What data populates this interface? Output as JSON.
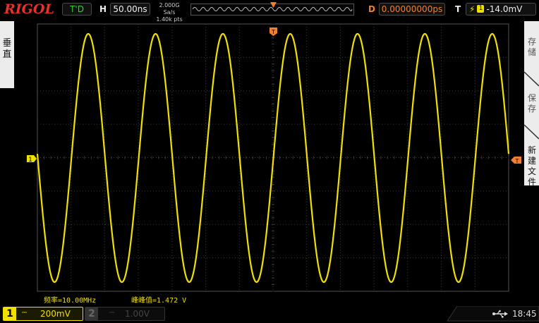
{
  "topbar": {
    "logo": "RIGOL",
    "run_state": "T'D",
    "h_label": "H",
    "timebase": "50.00ns",
    "sample_rate": "2.000G Sa/s",
    "memory_depth": "1.40k pts",
    "d_label": "D",
    "delay": "0.00000000ps",
    "t_label": "T",
    "trigger_source": "1",
    "trigger_level": "-14.0mV"
  },
  "left_tab": {
    "label": "垂直"
  },
  "right_panel": {
    "items": [
      "存储",
      "保存",
      "新建文件"
    ]
  },
  "markers": {
    "channel_marker": "1",
    "trigger_level_marker": "T",
    "trigger_position_marker": "T"
  },
  "measurements": [
    {
      "text": "频率=10.00MHz"
    },
    {
      "text": "峰峰值=1.472 V"
    }
  ],
  "bottombar": {
    "ch1_number": "1",
    "ch1_coupling": "⎓",
    "ch1_scale": "200mV",
    "ch2_number": "2",
    "ch2_coupling": "⎓",
    "ch2_scale": "1.00V",
    "clock": "18:45"
  },
  "colors": {
    "trace": "#f0e000",
    "trigger": "#f08030",
    "grid": "#3c3c3c"
  },
  "chart_data": {
    "type": "line",
    "series": [
      {
        "waveform": "sine",
        "frequency_hz": 10000000,
        "peak_to_peak_v": 1.472,
        "cycles_visible": 7
      }
    ],
    "grid": true
  }
}
